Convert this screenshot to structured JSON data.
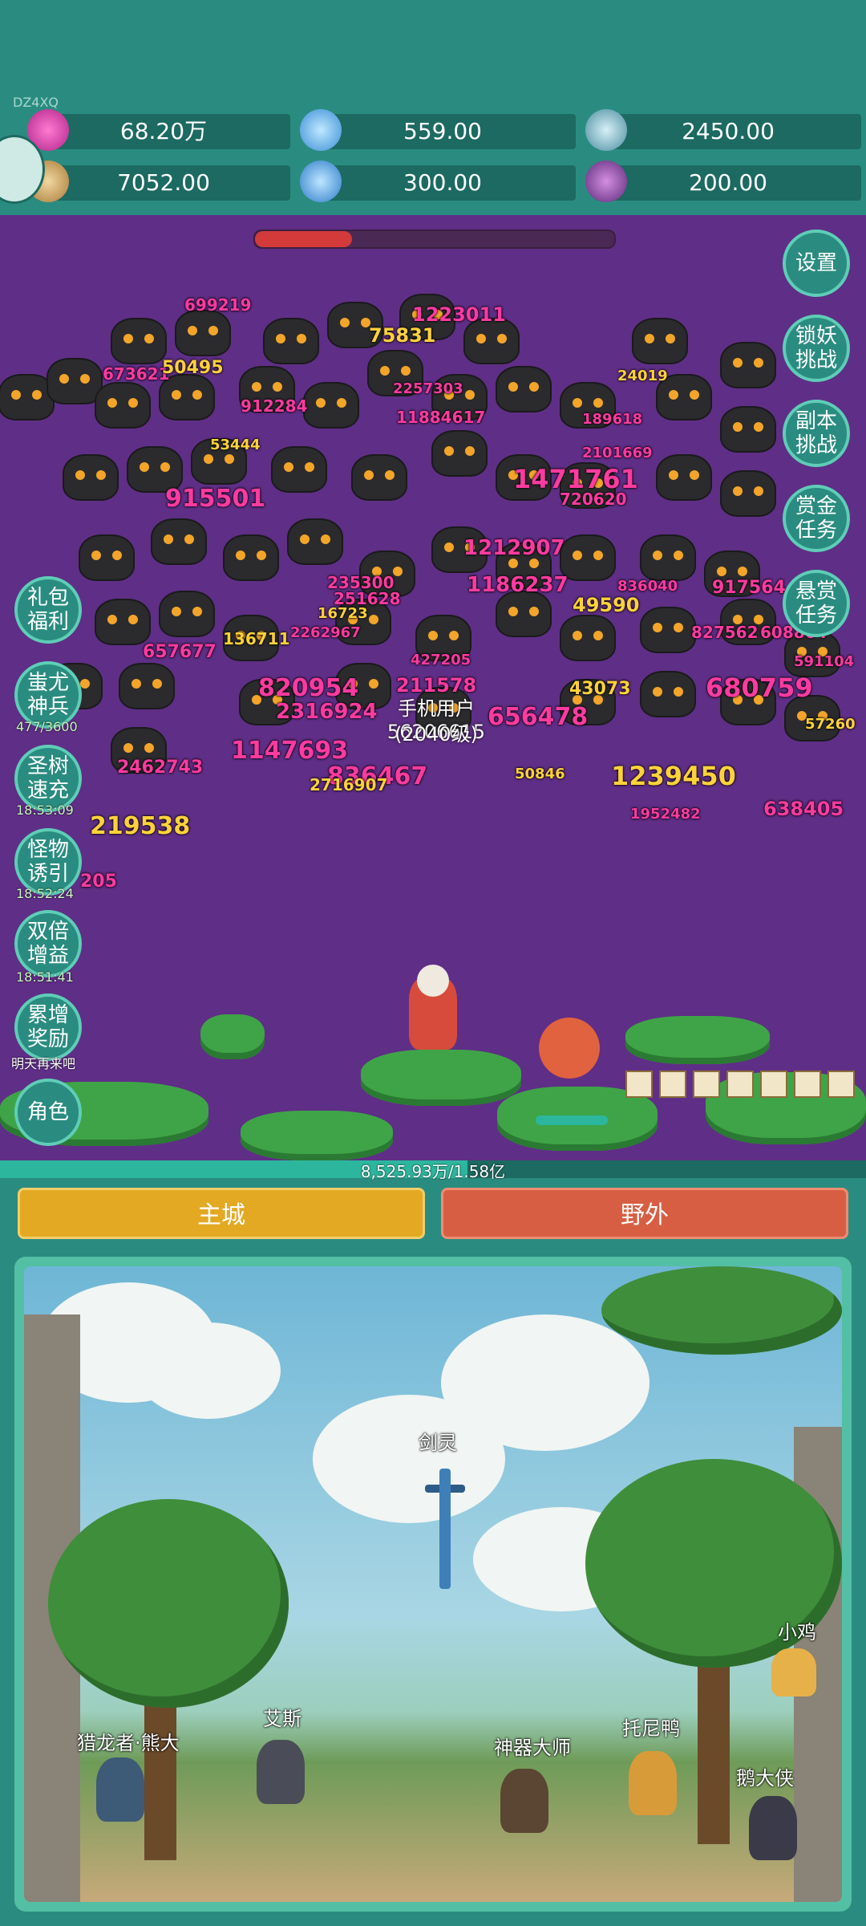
{
  "header": {
    "uid": "DZ4XQ",
    "resources": [
      {
        "icon": "gem-pink-icon",
        "value": "68.20万"
      },
      {
        "icon": "crystal-orb-icon",
        "value": "559.00"
      },
      {
        "icon": "world-orb-icon",
        "value": "2450.00"
      },
      {
        "icon": "scroll-icon",
        "value": "7052.00"
      },
      {
        "icon": "diamond-shard-icon",
        "value": "300.00"
      },
      {
        "icon": "purple-pot-icon",
        "value": "200.00"
      }
    ]
  },
  "right_buttons": [
    {
      "l1": "设置",
      "l2": ""
    },
    {
      "l1": "锁妖",
      "l2": "挑战"
    },
    {
      "l1": "副本",
      "l2": "挑战"
    },
    {
      "l1": "赏金",
      "l2": "任务"
    },
    {
      "l1": "悬赏",
      "l2": "任务"
    }
  ],
  "left_buttons": [
    {
      "l1": "礼包",
      "l2": "福利",
      "timer": ""
    },
    {
      "l1": "蚩尤",
      "l2": "神兵",
      "timer": "477/3600"
    },
    {
      "l1": "圣树",
      "l2": "速充",
      "timer": "18:53:09"
    },
    {
      "l1": "怪物",
      "l2": "诱引",
      "timer": "18:52:24"
    },
    {
      "l1": "双倍",
      "l2": "增益",
      "timer": "18:51:41"
    },
    {
      "l1": "累增",
      "l2": "奖励",
      "timer": "明天再来吧"
    },
    {
      "l1": "角色",
      "l2": "",
      "timer": ""
    }
  ],
  "damage_numbers": [
    {
      "v": "699219",
      "c": "pink"
    },
    {
      "v": "1223011",
      "c": "pink"
    },
    {
      "v": "75831",
      "c": "yellow"
    },
    {
      "v": "673621",
      "c": "pink"
    },
    {
      "v": "50495",
      "c": "yellow"
    },
    {
      "v": "2257303",
      "c": "pink"
    },
    {
      "v": "24019",
      "c": "yellow"
    },
    {
      "v": "912284",
      "c": "pink"
    },
    {
      "v": "11884617",
      "c": "pink"
    },
    {
      "v": "189618",
      "c": "pink"
    },
    {
      "v": "53444",
      "c": "yellow"
    },
    {
      "v": "2101669",
      "c": "pink"
    },
    {
      "v": "1471761",
      "c": "pink"
    },
    {
      "v": "915501",
      "c": "pink"
    },
    {
      "v": "720620",
      "c": "pink"
    },
    {
      "v": "1212907",
      "c": "pink"
    },
    {
      "v": "235300",
      "c": "pink"
    },
    {
      "v": "1186237",
      "c": "pink"
    },
    {
      "v": "836040",
      "c": "pink"
    },
    {
      "v": "917564",
      "c": "pink"
    },
    {
      "v": "251628",
      "c": "pink"
    },
    {
      "v": "16723",
      "c": "yellow"
    },
    {
      "v": "49590",
      "c": "yellow"
    },
    {
      "v": "136711",
      "c": "yellow"
    },
    {
      "v": "2262967",
      "c": "pink"
    },
    {
      "v": "827562",
      "c": "pink"
    },
    {
      "v": "608864",
      "c": "pink"
    },
    {
      "v": "657677",
      "c": "pink"
    },
    {
      "v": "427205",
      "c": "pink"
    },
    {
      "v": "591104",
      "c": "pink"
    },
    {
      "v": "820954",
      "c": "pink"
    },
    {
      "v": "211578",
      "c": "pink"
    },
    {
      "v": "680759",
      "c": "pink"
    },
    {
      "v": "2316924",
      "c": "pink"
    },
    {
      "v": "43073",
      "c": "yellow"
    },
    {
      "v": "656478",
      "c": "pink"
    },
    {
      "v": "57260",
      "c": "yellow"
    },
    {
      "v": "1147693",
      "c": "pink"
    },
    {
      "v": "2462743",
      "c": "pink"
    },
    {
      "v": "50846",
      "c": "yellow"
    },
    {
      "v": "836467",
      "c": "pink"
    },
    {
      "v": "1239450",
      "c": "yellow"
    },
    {
      "v": "2716907",
      "c": "yellow"
    },
    {
      "v": "638405",
      "c": "pink"
    },
    {
      "v": "219538",
      "c": "yellow"
    },
    {
      "v": "1952482",
      "c": "pink"
    },
    {
      "v": "205",
      "c": "pink"
    }
  ],
  "player": {
    "name": "手机用户56206615",
    "level": "(2040级)"
  },
  "xp": {
    "text": "8,525.93万/1.58亿",
    "fraction": 0.54
  },
  "boss_hp_fraction": 0.27,
  "tabs": {
    "city": "主城",
    "field": "野外"
  },
  "town_npcs": [
    {
      "name": "剑灵"
    },
    {
      "name": "小鸡"
    },
    {
      "name": "艾斯"
    },
    {
      "name": "猎龙者·熊大"
    },
    {
      "name": "托尼鸭"
    },
    {
      "name": "神器大师"
    },
    {
      "name": "鹅大侠"
    }
  ]
}
